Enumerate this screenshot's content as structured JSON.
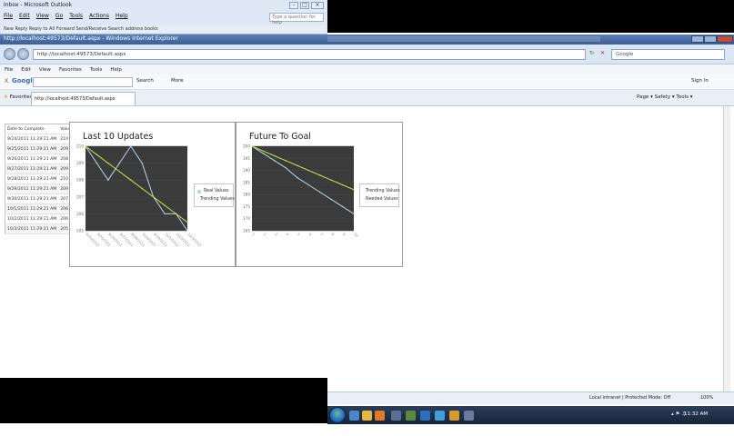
{
  "outlook": {
    "title": "Inbox - Microsoft Outlook",
    "menu": [
      "File",
      "Edit",
      "View",
      "Go",
      "Tools",
      "Actions",
      "Help"
    ],
    "ask_placeholder": "Type a question for help",
    "toolbar_text": "New  Reply  Reply to All  Forward  Send/Receive  Search address books"
  },
  "ie": {
    "title": "http://localhost:49573/Default.aspx - Windows Internet Explorer",
    "address": "http://localhost:49573/Default.aspx",
    "search_placeholder": "Google",
    "menu": [
      "File",
      "Edit",
      "View",
      "Favorites",
      "Tools",
      "Help"
    ],
    "google_close": "X",
    "google_logo": "Google",
    "google_search_label": "Search",
    "google_more_label": "More",
    "google_signin": "Sign In",
    "favorites_label": "Favorites",
    "tab_title": "http://localhost:49573/Default.aspx",
    "command_bar": "Page ▾  Safety ▾  Tools ▾"
  },
  "table": {
    "headers": [
      "Date to Complete",
      "Value"
    ],
    "rows": [
      [
        "9/24/2011 11:29:21 AM",
        "210"
      ],
      [
        "9/25/2011 11:29:21 AM",
        "209"
      ],
      [
        "9/26/2011 11:29:21 AM",
        "208"
      ],
      [
        "9/27/2011 11:29:21 AM",
        "209"
      ],
      [
        "9/28/2011 11:29:21 AM",
        "210"
      ],
      [
        "9/29/2011 11:29:21 AM",
        "209"
      ],
      [
        "9/30/2011 11:29:21 AM",
        "207"
      ],
      [
        "10/1/2011 11:29:21 AM",
        "206"
      ],
      [
        "10/2/2011 11:29:21 AM",
        "206"
      ],
      [
        "10/3/2011 11:29:21 AM",
        "205"
      ]
    ]
  },
  "chart_data": [
    {
      "type": "line",
      "title": "Last 10 Updates",
      "xlabel": "",
      "ylabel": "",
      "ylim": [
        205,
        210
      ],
      "yticks": [
        "210",
        "209",
        "208",
        "207",
        "206",
        "205"
      ],
      "categories": [
        "9/24/2011",
        "9/25/2011",
        "9/26/2011",
        "9/27/2011",
        "9/28/2011",
        "9/29/2011",
        "9/30/2011",
        "10/1/2011",
        "10/2/2011",
        "10/3/2011"
      ],
      "series": [
        {
          "name": "Real Values",
          "color": "#b9d6e8",
          "values": [
            210,
            209,
            208,
            209,
            210,
            209,
            207,
            206,
            206,
            205
          ]
        },
        {
          "name": "Trending Values",
          "color": "#c8e04a",
          "values": [
            210,
            209.5,
            209,
            208.5,
            208,
            207.5,
            207,
            206.5,
            206,
            205.5
          ]
        }
      ],
      "legend": "right",
      "background": "#3b3b3b"
    },
    {
      "type": "line",
      "title": "Future To Goal",
      "xlabel": "",
      "ylabel": "",
      "ylim": [
        165,
        200
      ],
      "yticks": [
        "200",
        "195",
        "190",
        "185",
        "180",
        "175",
        "170",
        "165"
      ],
      "categories": [
        "1",
        "2",
        "3",
        "4",
        "5",
        "6",
        "7",
        "8",
        "9",
        "10"
      ],
      "series": [
        {
          "name": "Trending Values",
          "color": "#b9d6e8",
          "values": [
            200,
            197,
            194,
            191,
            187,
            184,
            181,
            178,
            175,
            172
          ]
        },
        {
          "name": "Needed Values",
          "color": "#c8e04a",
          "values": [
            200,
            198,
            196,
            194,
            192,
            190,
            188,
            186,
            184,
            182
          ]
        }
      ],
      "legend": "right",
      "background": "#3b3b3b"
    }
  ],
  "status": {
    "zone": "Local intranet | Protected Mode: Off",
    "zoom": "100%"
  },
  "taskbar": {
    "time": "11:32 AM"
  }
}
